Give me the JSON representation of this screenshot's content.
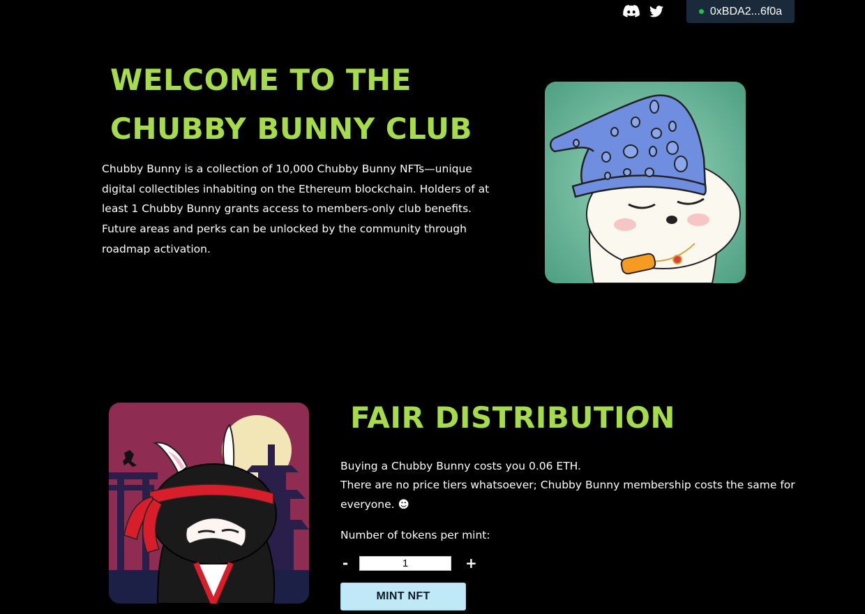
{
  "header": {
    "icons": [
      "discord-icon",
      "twitter-icon"
    ],
    "wallet": {
      "address": "0xBDA2...6f0a",
      "status_color": "#1fc24a"
    }
  },
  "welcome": {
    "title_line1": "WELCOME TO THE",
    "title_line2": "CHUBBY BUNNY CLUB",
    "description": "Chubby Bunny is a collection of 10,000 Chubby Bunny NFTs—unique digital collectibles inhabiting on the Ethereum blockchain. Holders of at least 1 Chubby Bunny grants access to members-only club benefits. Future areas and perks can be unlocked by the community through roadmap activation."
  },
  "distribution": {
    "title": "FAIR DISTRIBUTION",
    "line1": "Buying a Chubby Bunny costs you 0.06 ETH.",
    "line2": "There are no price tiers whatsoever; Chubby Bunny membership costs the same for everyone. ☻",
    "tokens_label": "Number of tokens per mint:",
    "minus": "-",
    "plus": "+",
    "quantity": "1",
    "mint_label": "MINT NFT"
  },
  "colors": {
    "accent": "#a6dc4a",
    "background": "#000000",
    "mint_button": "#bfe9f7",
    "wallet_bg": "#1a2a3a"
  }
}
